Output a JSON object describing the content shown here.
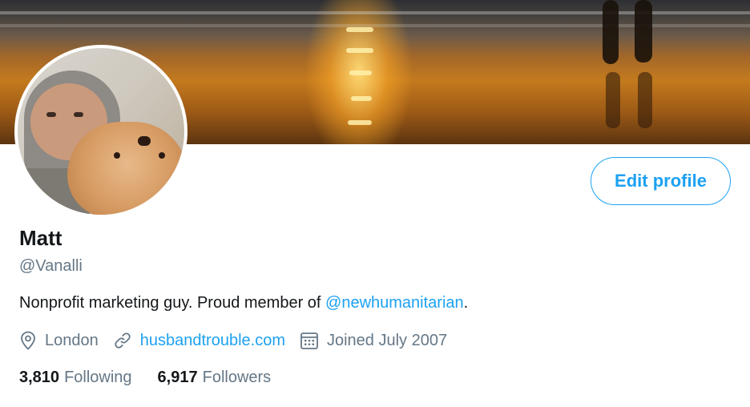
{
  "profile": {
    "name": "Matt",
    "handle": "@Vanalli",
    "bio_text": "Nonprofit marketing guy. Proud member of ",
    "bio_mention": "@newhumanitarian",
    "bio_end": "."
  },
  "meta": {
    "location": "London",
    "website": "husbandtrouble.com",
    "joined": "Joined July 2007"
  },
  "stats": {
    "following_count": "3,810",
    "following_label": "Following",
    "followers_count": "6,917",
    "followers_label": "Followers"
  },
  "actions": {
    "edit_profile_label": "Edit profile"
  },
  "icons": {
    "location": "location-pin-icon",
    "link": "link-icon",
    "calendar": "calendar-icon"
  },
  "colors": {
    "accent": "#1da1f2",
    "secondary_text": "#657786",
    "primary_text": "#14171a"
  }
}
